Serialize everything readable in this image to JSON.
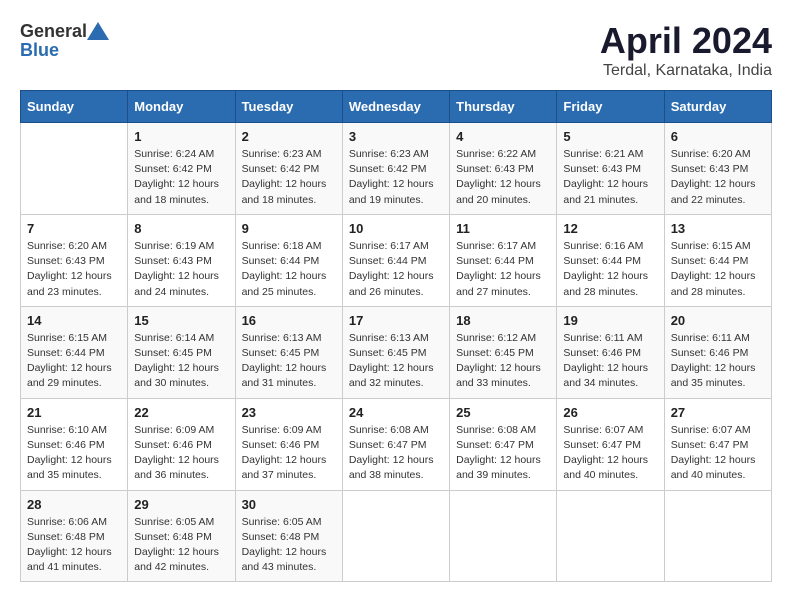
{
  "header": {
    "logo_general": "General",
    "logo_blue": "Blue",
    "title": "April 2024",
    "subtitle": "Terdal, Karnataka, India"
  },
  "columns": [
    "Sunday",
    "Monday",
    "Tuesday",
    "Wednesday",
    "Thursday",
    "Friday",
    "Saturday"
  ],
  "weeks": [
    [
      {
        "day": "",
        "info": ""
      },
      {
        "day": "1",
        "info": "Sunrise: 6:24 AM\nSunset: 6:42 PM\nDaylight: 12 hours\nand 18 minutes."
      },
      {
        "day": "2",
        "info": "Sunrise: 6:23 AM\nSunset: 6:42 PM\nDaylight: 12 hours\nand 18 minutes."
      },
      {
        "day": "3",
        "info": "Sunrise: 6:23 AM\nSunset: 6:42 PM\nDaylight: 12 hours\nand 19 minutes."
      },
      {
        "day": "4",
        "info": "Sunrise: 6:22 AM\nSunset: 6:43 PM\nDaylight: 12 hours\nand 20 minutes."
      },
      {
        "day": "5",
        "info": "Sunrise: 6:21 AM\nSunset: 6:43 PM\nDaylight: 12 hours\nand 21 minutes."
      },
      {
        "day": "6",
        "info": "Sunrise: 6:20 AM\nSunset: 6:43 PM\nDaylight: 12 hours\nand 22 minutes."
      }
    ],
    [
      {
        "day": "7",
        "info": "Sunrise: 6:20 AM\nSunset: 6:43 PM\nDaylight: 12 hours\nand 23 minutes."
      },
      {
        "day": "8",
        "info": "Sunrise: 6:19 AM\nSunset: 6:43 PM\nDaylight: 12 hours\nand 24 minutes."
      },
      {
        "day": "9",
        "info": "Sunrise: 6:18 AM\nSunset: 6:44 PM\nDaylight: 12 hours\nand 25 minutes."
      },
      {
        "day": "10",
        "info": "Sunrise: 6:17 AM\nSunset: 6:44 PM\nDaylight: 12 hours\nand 26 minutes."
      },
      {
        "day": "11",
        "info": "Sunrise: 6:17 AM\nSunset: 6:44 PM\nDaylight: 12 hours\nand 27 minutes."
      },
      {
        "day": "12",
        "info": "Sunrise: 6:16 AM\nSunset: 6:44 PM\nDaylight: 12 hours\nand 28 minutes."
      },
      {
        "day": "13",
        "info": "Sunrise: 6:15 AM\nSunset: 6:44 PM\nDaylight: 12 hours\nand 28 minutes."
      }
    ],
    [
      {
        "day": "14",
        "info": "Sunrise: 6:15 AM\nSunset: 6:44 PM\nDaylight: 12 hours\nand 29 minutes."
      },
      {
        "day": "15",
        "info": "Sunrise: 6:14 AM\nSunset: 6:45 PM\nDaylight: 12 hours\nand 30 minutes."
      },
      {
        "day": "16",
        "info": "Sunrise: 6:13 AM\nSunset: 6:45 PM\nDaylight: 12 hours\nand 31 minutes."
      },
      {
        "day": "17",
        "info": "Sunrise: 6:13 AM\nSunset: 6:45 PM\nDaylight: 12 hours\nand 32 minutes."
      },
      {
        "day": "18",
        "info": "Sunrise: 6:12 AM\nSunset: 6:45 PM\nDaylight: 12 hours\nand 33 minutes."
      },
      {
        "day": "19",
        "info": "Sunrise: 6:11 AM\nSunset: 6:46 PM\nDaylight: 12 hours\nand 34 minutes."
      },
      {
        "day": "20",
        "info": "Sunrise: 6:11 AM\nSunset: 6:46 PM\nDaylight: 12 hours\nand 35 minutes."
      }
    ],
    [
      {
        "day": "21",
        "info": "Sunrise: 6:10 AM\nSunset: 6:46 PM\nDaylight: 12 hours\nand 35 minutes."
      },
      {
        "day": "22",
        "info": "Sunrise: 6:09 AM\nSunset: 6:46 PM\nDaylight: 12 hours\nand 36 minutes."
      },
      {
        "day": "23",
        "info": "Sunrise: 6:09 AM\nSunset: 6:46 PM\nDaylight: 12 hours\nand 37 minutes."
      },
      {
        "day": "24",
        "info": "Sunrise: 6:08 AM\nSunset: 6:47 PM\nDaylight: 12 hours\nand 38 minutes."
      },
      {
        "day": "25",
        "info": "Sunrise: 6:08 AM\nSunset: 6:47 PM\nDaylight: 12 hours\nand 39 minutes."
      },
      {
        "day": "26",
        "info": "Sunrise: 6:07 AM\nSunset: 6:47 PM\nDaylight: 12 hours\nand 40 minutes."
      },
      {
        "day": "27",
        "info": "Sunrise: 6:07 AM\nSunset: 6:47 PM\nDaylight: 12 hours\nand 40 minutes."
      }
    ],
    [
      {
        "day": "28",
        "info": "Sunrise: 6:06 AM\nSunset: 6:48 PM\nDaylight: 12 hours\nand 41 minutes."
      },
      {
        "day": "29",
        "info": "Sunrise: 6:05 AM\nSunset: 6:48 PM\nDaylight: 12 hours\nand 42 minutes."
      },
      {
        "day": "30",
        "info": "Sunrise: 6:05 AM\nSunset: 6:48 PM\nDaylight: 12 hours\nand 43 minutes."
      },
      {
        "day": "",
        "info": ""
      },
      {
        "day": "",
        "info": ""
      },
      {
        "day": "",
        "info": ""
      },
      {
        "day": "",
        "info": ""
      }
    ]
  ]
}
